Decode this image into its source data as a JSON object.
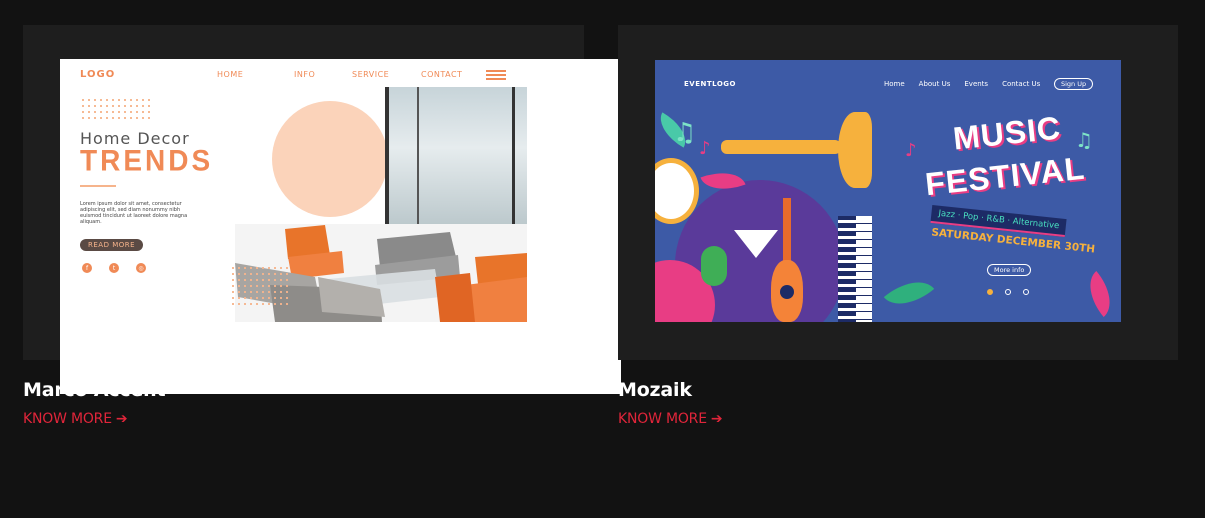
{
  "cards": [
    {
      "title": "Marco Accent",
      "link_label": "KNOW MORE",
      "arrow_icon": "arrow-right-icon",
      "preview": {
        "logo": "LOGO",
        "nav": [
          "HOME",
          "INFO",
          "SERVICE",
          "CONTACT"
        ],
        "heading_line1": "Home  Decor",
        "heading_line2": "TRENDS",
        "body": "Lorem ipsum dolor sit amet, consectetur adipiscing elit, sed diam nonummy nibh euismod tincidunt ut laoreet dolore magna aliquam.",
        "cta": "READ MORE",
        "socials": [
          "facebook-icon",
          "twitter-icon",
          "instagram-icon"
        ]
      }
    },
    {
      "title": "Mozaik",
      "link_label": "KNOW MORE",
      "arrow_icon": "arrow-right-icon",
      "preview": {
        "logo": "EVENTLOGO",
        "nav": [
          "Home",
          "About Us",
          "Events",
          "Contact Us"
        ],
        "signup": "Sign Up",
        "title_line1": "MUSIC",
        "title_line2": "FESTIVAL",
        "tagline": "Jazz · Pop · R&B · Alternative",
        "date": "SATURDAY DECEMBER 30TH",
        "cta": "More info"
      }
    }
  ],
  "colors": {
    "background": "#121212",
    "card_frame": "#1e1e1e",
    "accent_red": "#e0253a",
    "decor_orange": "#f08a56",
    "music_blue": "#3d5aa6"
  }
}
